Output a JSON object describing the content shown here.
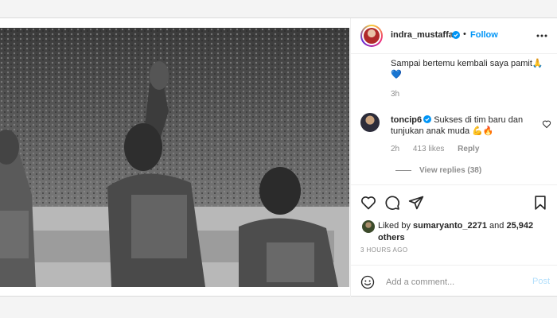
{
  "post": {
    "author": {
      "username": "indra_mustaffa",
      "verified": true,
      "follow_label": "Follow",
      "separator": "•"
    },
    "caption_lines": [
      "Sampai bertemu kembali saya pamit🙏",
      "💙"
    ],
    "caption_time": "3h",
    "comment": {
      "username": "toncip6",
      "verified": true,
      "text": "Sukses di tim baru dan tunjukan anak muda 💪🔥",
      "time": "2h",
      "likes": "413 likes",
      "reply_label": "Reply",
      "view_replies": "View replies (38)"
    },
    "likes": {
      "prefix": "Liked by ",
      "user": "sumaryanto_2271",
      "middle": " and ",
      "count": "25,942 others"
    },
    "time_ago": "3 HOURS AGO",
    "add_comment": {
      "placeholder": "Add a comment...",
      "post_label": "Post"
    },
    "colors": {
      "link_blue": "#0095f6",
      "post_disabled": "#b2dffc",
      "muted": "#8e8e8e",
      "text": "#262626"
    },
    "icons": [
      "verified-badge-icon",
      "more-options-icon",
      "heart-icon",
      "comment-icon",
      "share-icon",
      "bookmark-icon",
      "emoji-icon"
    ]
  }
}
